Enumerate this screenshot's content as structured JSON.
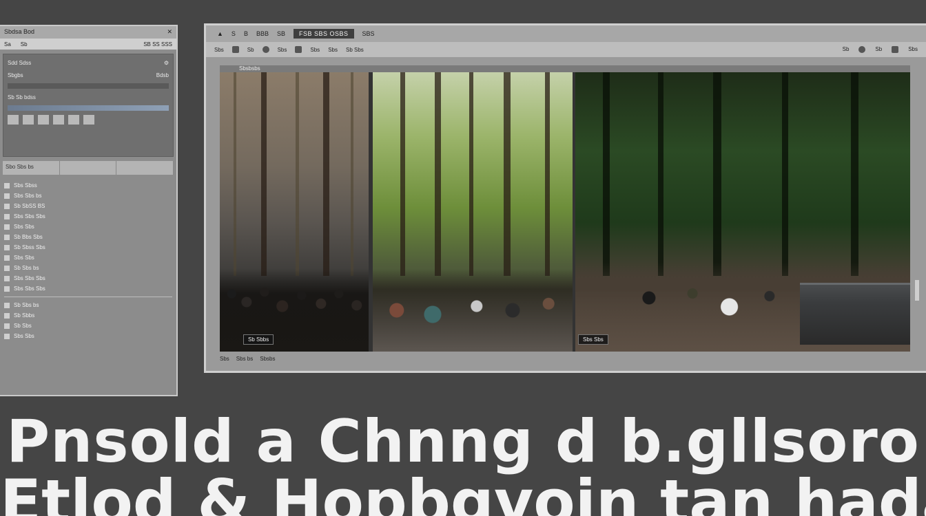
{
  "left_panel": {
    "title": "Sbdsa Bod",
    "toolbar": [
      "Sa",
      "Sb",
      "SB SS SSS"
    ],
    "block_lines": [
      {
        "label": "Sdd Sdss",
        "value": ""
      },
      {
        "label": "Sbgbs",
        "value": "Bdsb"
      },
      {
        "label": "Sb Sb bdss",
        "value": ""
      }
    ],
    "tabs": [
      "Sbo Sbs bs",
      "",
      ""
    ],
    "list_items": [
      "Sbs Sbss",
      "Sbs Sbs bs",
      "Sb SbSS BS",
      "Sbs Sbs Sbs",
      "Sbs Sbs",
      "Sb Bbs Sbs",
      "Sb Sbss Sbs",
      "Sbs Sbs",
      "Sb Sbs bs",
      "Sbs Sbs Sbs",
      "Sbs Sbs Sbs"
    ],
    "list_items_2": [
      "Sb Sbs bs",
      "Sb Sbbs",
      "Sb Sbs",
      "Sbs Sbs"
    ]
  },
  "main_window": {
    "title": "FSB SBS OSBS",
    "titlebar_items": [
      "S",
      "B",
      "BBB",
      "SB",
      "SBS"
    ],
    "toolbar_left": [
      "Sbs",
      "Sb",
      "Sbs",
      "Sbs",
      "Sbs",
      "Sb Sbs"
    ],
    "toolbar_right": [
      "Sb",
      "Sb",
      "Sbs"
    ],
    "canvas_label": "Sbsbsbs",
    "captions": [
      "Sb Sbbs",
      "Sbs Sbs"
    ],
    "status": [
      "Sbs",
      "Sbs bs",
      "Sbsbs"
    ]
  },
  "headline": {
    "line1": "Pnsold a Chnng d b.gllsoro",
    "line2": "Etlod & Hopbgvoin tan hadasst"
  }
}
